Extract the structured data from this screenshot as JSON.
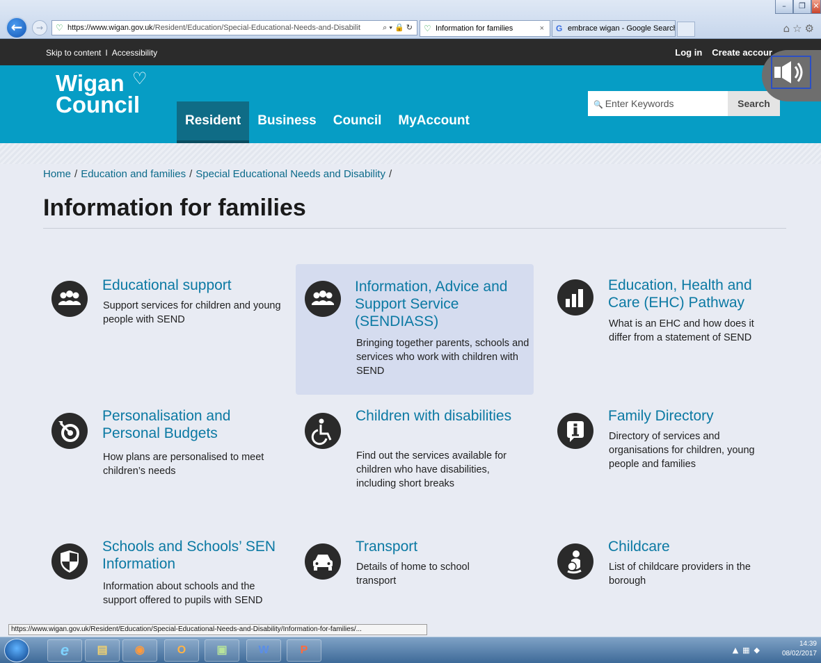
{
  "browser": {
    "url_host": "https://www.wigan.gov.uk",
    "url_path": "/Resident/Education/Special-Educational-Needs-and-Disabilit",
    "tabs": [
      {
        "label": "Information for families",
        "active": true
      },
      {
        "label": "embrace wigan - Google Search",
        "active": false
      }
    ],
    "status_url": "https://www.wigan.gov.uk/Resident/Education/Special-Educational-Needs-and-Disability/Information-for-families/..."
  },
  "utility": {
    "skip": "Skip to content",
    "separator": "I",
    "accessibility": "Accessibility",
    "login": "Log in",
    "create": "Create accour"
  },
  "header": {
    "logo_line1": "Wigan",
    "logo_line2": "Council",
    "nav": [
      "Resident",
      "Business",
      "Council",
      "MyAccount"
    ],
    "search_placeholder": "Enter Keywords",
    "search_button": "Search"
  },
  "breadcrumb": [
    "Home",
    "Education and families",
    "Special Educational Needs and Disability"
  ],
  "page_title": "Information for families",
  "cards": [
    {
      "title": "Educational support",
      "desc": "Support services for children and young people with SEND",
      "icon": "group-icon"
    },
    {
      "title": "Information, Advice and Support Service (SENDIASS)",
      "desc": "Bringing together parents, schools and services who work with children with SEND",
      "icon": "group-icon"
    },
    {
      "title": "Education, Health and Care (EHC) Pathway",
      "desc": "What is an EHC and how does it differ from a statement of SEND",
      "icon": "bar-chart-icon"
    },
    {
      "title": "Personalisation and Personal Budgets",
      "desc": "How plans are personalised to meet children’s needs",
      "icon": "target-icon"
    },
    {
      "title": "Children with disabilities",
      "desc": "Find out the services available for children who have disabilities, including short breaks",
      "icon": "wheelchair-icon"
    },
    {
      "title": "Family Directory",
      "desc": "Directory of services and organisations for children, young people and families",
      "icon": "info-icon"
    },
    {
      "title": "Schools and Schools’ SEN Information",
      "desc": "Information about schools and the support offered to pupils with SEND",
      "icon": "shield-icon"
    },
    {
      "title": "Transport",
      "desc": "Details of home to school transport",
      "icon": "car-icon"
    },
    {
      "title": "Childcare",
      "desc": "List of childcare providers in the borough",
      "icon": "mother-child-icon"
    }
  ],
  "taskbar": {
    "time": "14:39",
    "date": "08/02/2017"
  },
  "colors": {
    "brand_blue": "#069dc5",
    "nav_active": "#0f6c86",
    "link_blue": "#0b79a3",
    "highlight_card": "#d5dcef"
  }
}
